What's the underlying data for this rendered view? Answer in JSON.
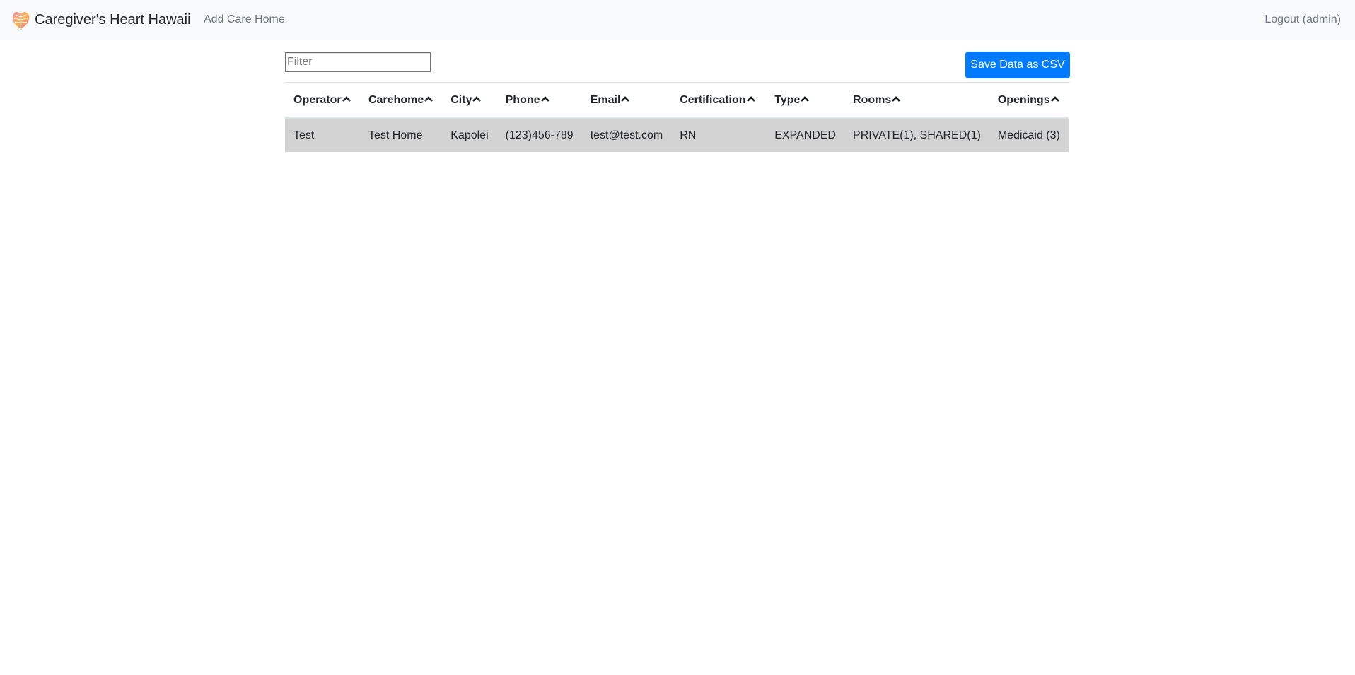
{
  "navbar": {
    "brand_name": "Caregiver's Heart Hawaii",
    "logo_icon": "monstera-leaf-icon",
    "add_care_home_label": "Add Care Home",
    "logout_label": "Logout (admin)"
  },
  "filter": {
    "placeholder": "Filter",
    "value": ""
  },
  "save_csv_label": "Save Data as CSV",
  "colors": {
    "accent": "#007bff",
    "navbar_bg": "#f8f9fa",
    "row_highlight": "#d3d3d3"
  },
  "table": {
    "sort_icon": "chevron-up-icon",
    "columns": [
      {
        "key": "operator",
        "label": "Operator"
      },
      {
        "key": "carehome",
        "label": "Carehome"
      },
      {
        "key": "city",
        "label": "City"
      },
      {
        "key": "phone",
        "label": "Phone"
      },
      {
        "key": "email",
        "label": "Email"
      },
      {
        "key": "certification",
        "label": "Certification"
      },
      {
        "key": "type",
        "label": "Type"
      },
      {
        "key": "rooms",
        "label": "Rooms"
      },
      {
        "key": "openings",
        "label": "Openings"
      }
    ],
    "rows": [
      {
        "operator": "Test",
        "carehome": "Test Home",
        "city": "Kapolei",
        "phone": "(123)456-789",
        "email": "test@test.com",
        "certification": "RN",
        "type": "EXPANDED",
        "rooms": "PRIVATE(1), SHARED(1)",
        "openings": "Medicaid (3)"
      }
    ]
  }
}
